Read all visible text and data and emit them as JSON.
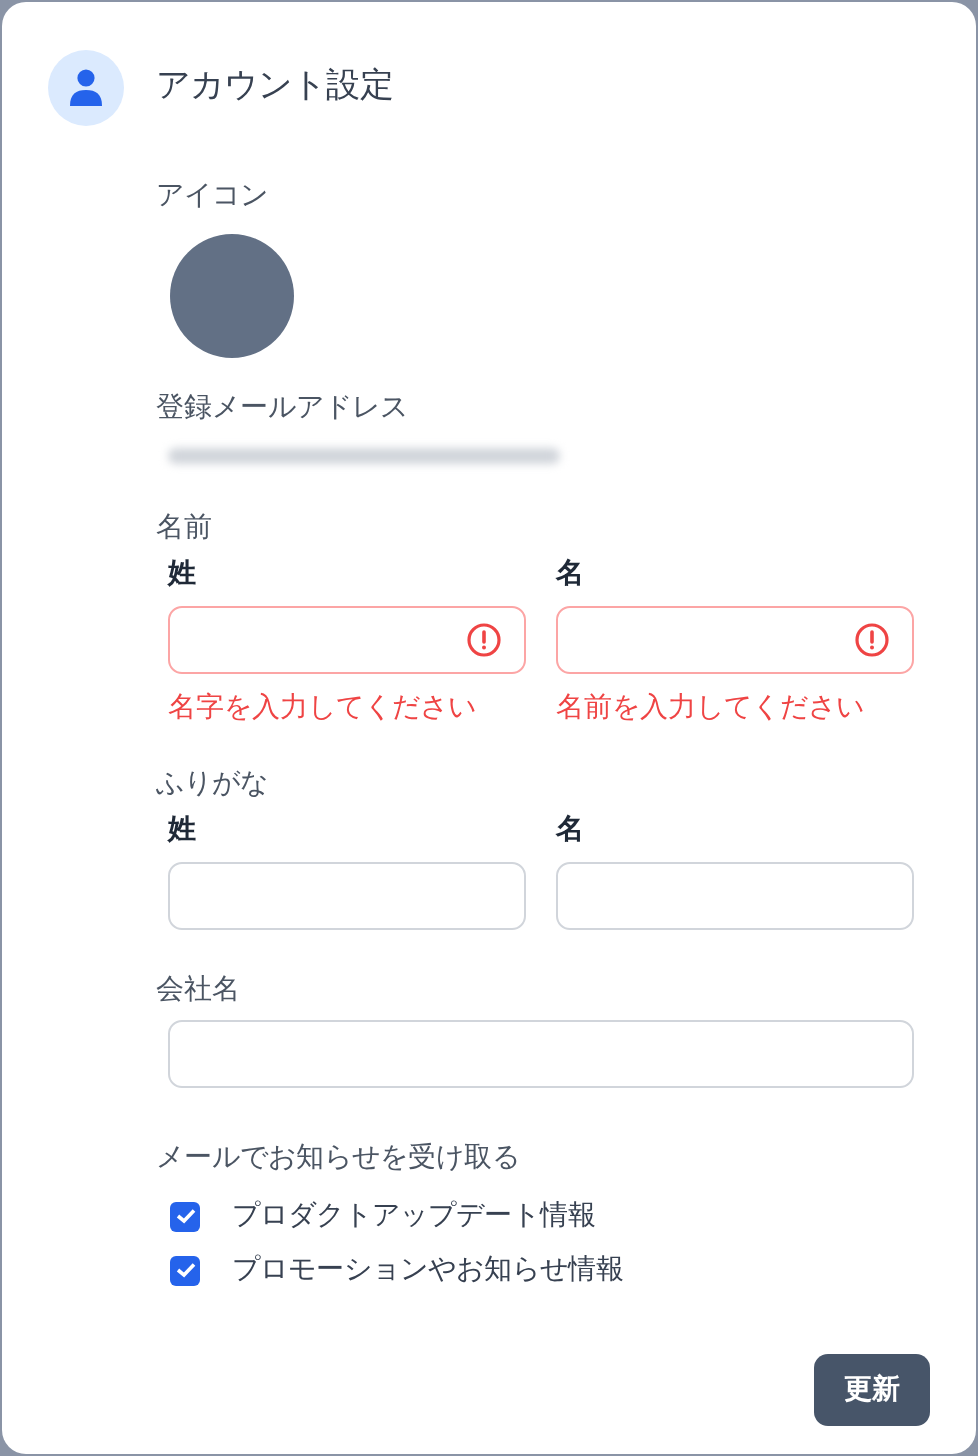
{
  "dialog": {
    "title": "アカウント設定"
  },
  "icon_section": {
    "label": "アイコン"
  },
  "email_section": {
    "label": "登録メールアドレス"
  },
  "name_section": {
    "label": "名前",
    "fields": [
      {
        "label": "姓",
        "error": true,
        "error_message": "名字を入力してください"
      },
      {
        "label": "名",
        "error": true,
        "error_message": "名前を入力してください"
      }
    ]
  },
  "furigana_section": {
    "label": "ふりがな",
    "fields": [
      {
        "label": "姓",
        "error": false
      },
      {
        "label": "名",
        "error": false
      }
    ]
  },
  "company_section": {
    "label": "会社名"
  },
  "notifications": {
    "label": "メールでお知らせを受け取る",
    "options": [
      {
        "label": "プロダクトアップデート情報",
        "checked": true
      },
      {
        "label": "プロモーションやお知らせ情報",
        "checked": true
      }
    ]
  },
  "buttons": [
    {
      "label": "更新"
    }
  ]
}
